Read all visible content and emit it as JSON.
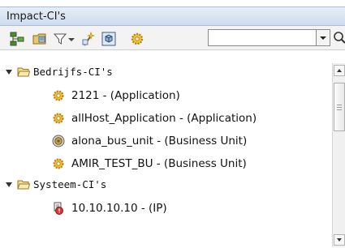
{
  "panel": {
    "title": "Impact-CI's"
  },
  "toolbar": {
    "icons": [
      "hierarchy-icon",
      "folder-config-icon",
      "filter-icon",
      "dropdown-arrow-icon",
      "wizard-icon",
      "cube-icon",
      "gear-icon"
    ],
    "search": {
      "value": "",
      "placeholder": ""
    }
  },
  "tree": {
    "groups": [
      {
        "label": "Bedrijfs-CI's",
        "expanded": true,
        "items": [
          {
            "label": "2121 - (Application)",
            "icon": "gear-icon"
          },
          {
            "label": "allHost_Application - (Application)",
            "icon": "gear-icon"
          },
          {
            "label": "alona_bus_unit - (Business Unit)",
            "icon": "business-unit-icon"
          },
          {
            "label": "AMIR_TEST_BU - (Business Unit)",
            "icon": "gear-icon"
          }
        ]
      },
      {
        "label": "Systeem-CI's",
        "expanded": true,
        "items": [
          {
            "label": "10.10.10.10 - (IP)",
            "icon": "ip-alert-icon"
          }
        ]
      }
    ]
  }
}
